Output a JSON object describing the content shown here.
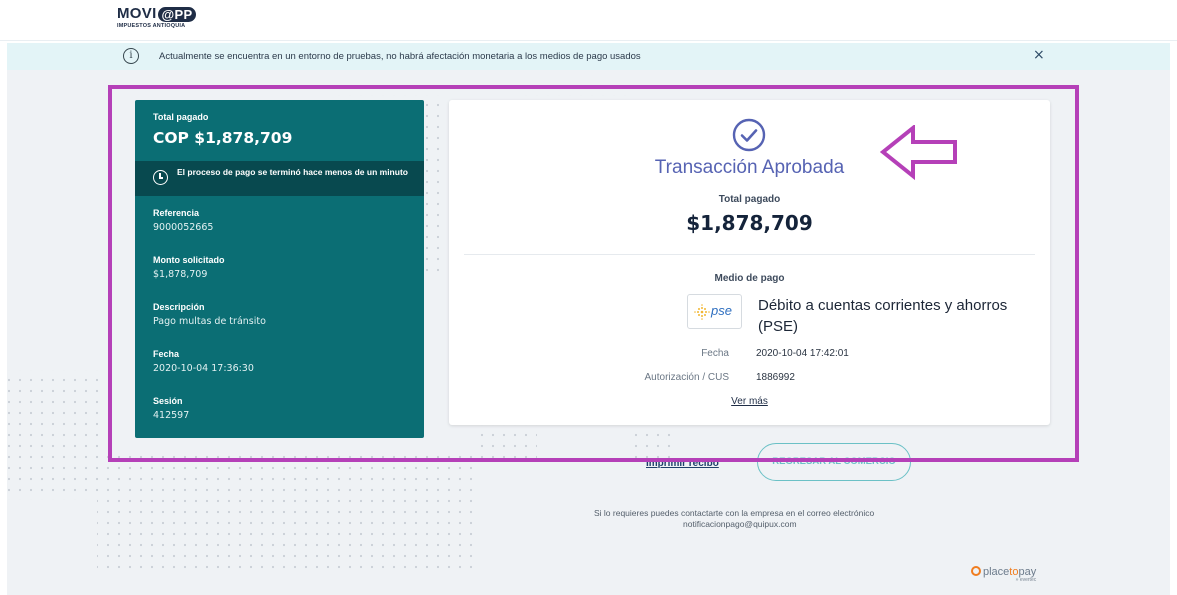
{
  "header": {
    "logo_main": "MOVI",
    "logo_at": "@PP",
    "logo_sub": "IMPUESTOS ANTIOQUIA"
  },
  "banner": {
    "info_icon": "i",
    "text": "Actualmente se encuentra en un entorno de pruebas, no habrá afectación monetaria a los medios de pago usados",
    "close": "×"
  },
  "summary": {
    "total_label": "Total pagado",
    "total_value": "COP $1,878,709",
    "time_notice": "El proceso de pago se terminó hace menos de un minuto",
    "fields": [
      {
        "label": "Referencia",
        "value": "9000052665"
      },
      {
        "label": "Monto solicitado",
        "value": "$1,878,709"
      },
      {
        "label": "Descripción",
        "value": "Pago multas de tránsito"
      },
      {
        "label": "Fecha",
        "value": "2020-10-04 17:36:30"
      },
      {
        "label": "Sesión",
        "value": "412597"
      }
    ]
  },
  "result": {
    "status_icon": "check-circle-icon",
    "title": "Transacción Aprobada",
    "total_label": "Total pagado",
    "total_value": "$1,878,709",
    "payment_method_label": "Medio de pago",
    "pse_logo_text": "pse",
    "payment_method": "Débito a cuentas corrientes y ahorros (PSE)",
    "rows": [
      {
        "label": "Fecha",
        "value": "2020-10-04 17:42:01"
      },
      {
        "label": "Autorización / CUS",
        "value": "1886992"
      }
    ],
    "more_link": "Ver más"
  },
  "actions": {
    "print_label": "Imprimir recibo",
    "return_label": "REGRESAR AL COMERCIO"
  },
  "footer": {
    "contact_line1": "Si lo requieres puedes contactarte con la empresa en el correo electrónico",
    "contact_email": "notificacionpago@quipux.com",
    "brand_main_1": "place",
    "brand_main_2": "to",
    "brand_main_3": "pay",
    "brand_sub": "» evertec"
  },
  "colors": {
    "teal_card": "#0b6e74",
    "teal_dark": "#08494f",
    "approved_title": "#5663b3",
    "highlight_border": "#b540b8",
    "banner_bg": "#e3f4f7"
  }
}
